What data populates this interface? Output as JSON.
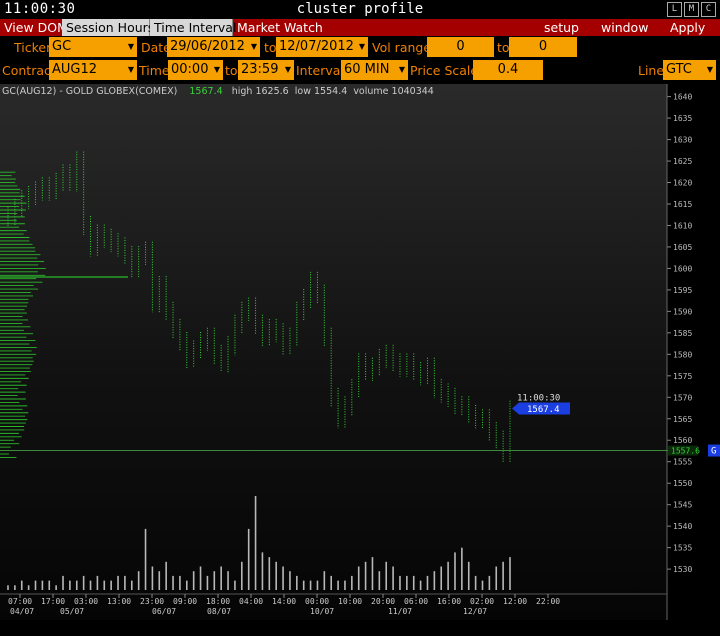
{
  "window": {
    "clock": "11:00:30",
    "title": "cluster profile",
    "buttons": [
      "L",
      "M",
      "C"
    ]
  },
  "toolbar": {
    "left": [
      {
        "label": "View DOM",
        "style": "red"
      },
      {
        "label": "Session Hours",
        "style": "light"
      },
      {
        "label": "Time Interval",
        "style": "light"
      },
      {
        "label": "Market Watch",
        "style": "red"
      }
    ],
    "setup_label": "setup",
    "window_label": "window",
    "apply_label": "Apply"
  },
  "form": {
    "ticker_label": "Ticker",
    "ticker_value": "GC",
    "date_label": "Date",
    "date_from": "29/06/2012",
    "date_to_label": "to",
    "date_to": "12/07/2012",
    "vol_range_label": "Vol range",
    "vol_from": "0",
    "vol_to_label": "to",
    "vol_to": "0",
    "contract_label": "Contract",
    "contract_value": "AUG12",
    "time_label": "Time",
    "time_from": "00:00",
    "time_to_label": "to",
    "time_to": "23:59",
    "interval_label": "Interval",
    "interval_value": "60 MIN",
    "price_scale_label": "Price Scale",
    "price_scale_value": "0.4",
    "line_label": "Line",
    "line_value": "GTC"
  },
  "chart_info": {
    "symbol": "GC(AUG12) - GOLD GLOBEX(COMEX)",
    "last": "1567.4",
    "high_label": "high",
    "high": "1625.6",
    "low_label": "low",
    "low": "1554.4",
    "volume_label": "volume",
    "volume": "1040344"
  },
  "chart_data": {
    "type": "ohlc-bar-with-volume-profile",
    "instrument": "GC(AUG12) - GOLD GLOBEX(COMEX)",
    "y_ticks": [
      1530,
      1535,
      1540,
      1545,
      1550,
      1555,
      1560,
      1565,
      1570,
      1575,
      1580,
      1585,
      1590,
      1595,
      1600,
      1605,
      1610,
      1615,
      1620,
      1625,
      1630,
      1635,
      1640
    ],
    "ylim": [
      1527,
      1642
    ],
    "x_time_labels": [
      "07:00",
      "17:00",
      "03:00",
      "13:00",
      "23:00",
      "09:00",
      "19:00",
      "05:00",
      "15:00",
      "01:00",
      "11:00",
      "21:00",
      "07:00",
      "17:00",
      "03:00",
      "13:00",
      "23:00",
      "09:00",
      "19:00",
      "05:00",
      "15:00",
      "01:00",
      "11:00",
      "21:00",
      "07:00",
      "17:00",
      "03:00",
      "13:00",
      "23:00",
      "09:00",
      "19:00",
      "05:00",
      "15:00",
      "01:00",
      "11:00",
      "21:00",
      "07:00",
      "17:00",
      "03:00",
      "13:00",
      "23:00",
      "09:00",
      "19:00",
      "05:00",
      "15:00",
      "01:00",
      "11:00",
      "21:00"
    ],
    "x_time_labels_visible": [
      "07:00",
      "17:00",
      "03:00",
      "13:00",
      "23:00",
      "09:00",
      "18:00",
      "04:00",
      "14:00",
      "00:00",
      "10:00",
      "20:00",
      "06:00",
      "16:00",
      "02:00",
      "12:00",
      "22:00"
    ],
    "x_date_labels": [
      "04/07",
      "05/07",
      "06/07",
      "08/07",
      "10/07",
      "11/07",
      "12/07"
    ],
    "price_series": [
      1612,
      1614,
      1616,
      1617,
      1618,
      1619,
      1618,
      1620,
      1622,
      1620,
      1625,
      1610,
      1605,
      1608,
      1607,
      1606,
      1605,
      1603,
      1600,
      1603,
      1604,
      1592,
      1596,
      1590,
      1586,
      1583,
      1579,
      1581,
      1583,
      1584,
      1580,
      1578,
      1582,
      1587,
      1590,
      1591,
      1587,
      1584,
      1586,
      1585,
      1582,
      1584,
      1590,
      1593,
      1597,
      1594,
      1584,
      1570,
      1565,
      1568,
      1572,
      1578,
      1576,
      1577,
      1579,
      1580,
      1578,
      1577,
      1578,
      1576,
      1575,
      1577,
      1572,
      1571,
      1570,
      1568,
      1568,
      1566,
      1565,
      1565,
      1562,
      1560,
      1557,
      1567
    ],
    "volume_series": [
      1,
      1,
      2,
      1,
      2,
      2,
      2,
      1,
      3,
      2,
      2,
      3,
      2,
      3,
      2,
      2,
      3,
      3,
      2,
      4,
      13,
      5,
      4,
      6,
      3,
      3,
      2,
      4,
      5,
      3,
      4,
      5,
      4,
      2,
      6,
      13,
      20,
      8,
      7,
      6,
      5,
      4,
      3,
      2,
      2,
      2,
      4,
      3,
      2,
      2,
      3,
      5,
      6,
      7,
      4,
      6,
      5,
      3,
      3,
      3,
      2,
      3,
      4,
      5,
      6,
      8,
      9,
      6,
      3,
      2,
      3,
      5,
      6,
      7
    ],
    "volume_profile_peak_price": 1598,
    "current_price": "1567.4",
    "current_time": "11:00:30",
    "gtc_line_price": "1557.6",
    "gtc_line_tag": "G"
  },
  "colors": {
    "accent_red": "#a50000",
    "field_orange": "#f6a000",
    "label_orange": "#f08000",
    "bars_green": "#3ad23a",
    "profile_green": "#2bb82b",
    "volume_gray": "#b8b8b8",
    "current_blue": "#1a3ee0"
  }
}
